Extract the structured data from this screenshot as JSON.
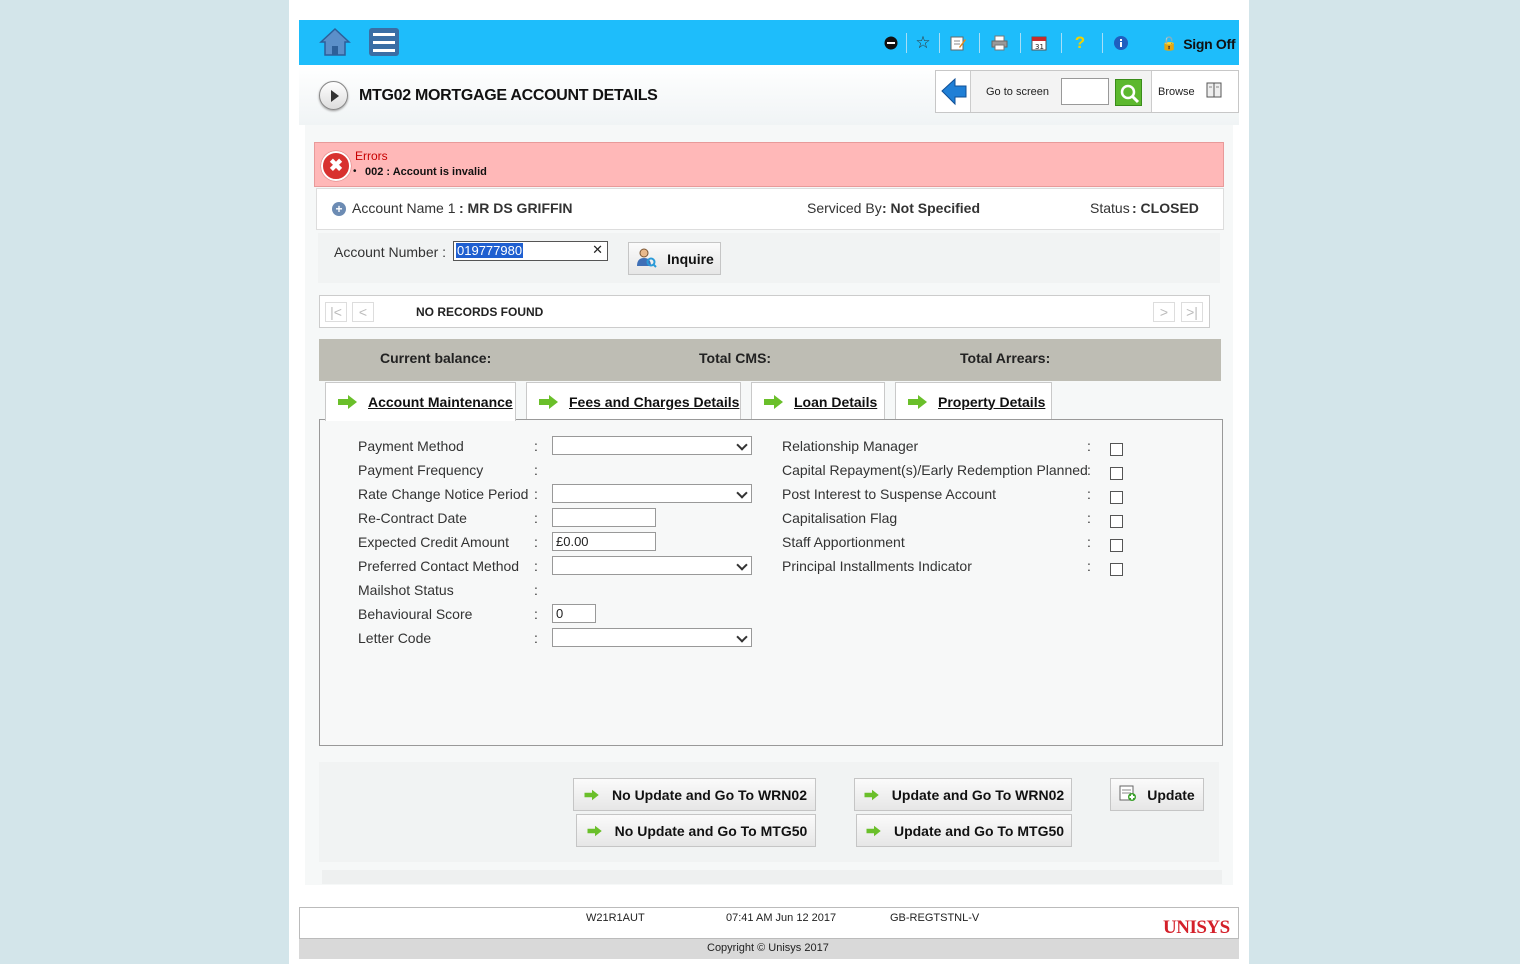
{
  "toolbar": {
    "sign_off": "Sign Off"
  },
  "title": "MTG02 MORTGAGE ACCOUNT DETAILS",
  "goto": {
    "label": "Go to screen",
    "value": "",
    "browse": "Browse"
  },
  "errors": {
    "title": "Errors",
    "message": "002 : Account is invalid"
  },
  "account_header": {
    "name_label": "Account Name 1",
    "name_value": ": MR DS GRIFFIN",
    "serviced_label": "Serviced By",
    "serviced_value": ": Not Specified",
    "status_label": "Status",
    "status_value": ": CLOSED"
  },
  "account_number": {
    "label": "Account Number :",
    "value": "019777980",
    "inquire": "Inquire"
  },
  "records": {
    "text": "NO RECORDS FOUND"
  },
  "summary": {
    "current_balance": "Current balance:",
    "total_cms": "Total CMS:",
    "total_arrears": "Total Arrears:"
  },
  "tabs": [
    {
      "label": "Account Maintenance"
    },
    {
      "label": "Fees and Charges Details"
    },
    {
      "label": "Loan Details"
    },
    {
      "label": "Property Details"
    }
  ],
  "form_left": [
    {
      "label": "Payment Method",
      "type": "select",
      "value": ""
    },
    {
      "label": "Payment Frequency",
      "type": "none",
      "value": ""
    },
    {
      "label": "Rate Change Notice Period",
      "type": "select",
      "value": ""
    },
    {
      "label": "Re-Contract Date",
      "type": "text",
      "value": ""
    },
    {
      "label": "Expected Credit Amount",
      "type": "text",
      "value": "£0.00"
    },
    {
      "label": "Preferred Contact Method",
      "type": "select",
      "value": ""
    },
    {
      "label": "Mailshot Status",
      "type": "none",
      "value": ""
    },
    {
      "label": "Behavioural Score",
      "type": "text",
      "value": "0"
    },
    {
      "label": "Letter Code",
      "type": "select",
      "value": ""
    }
  ],
  "form_right": [
    {
      "label": "Relationship Manager",
      "checked": false
    },
    {
      "label": "Capital Repayment(s)/Early Redemption Planned",
      "checked": false
    },
    {
      "label": "Post Interest to Suspense Account",
      "checked": false
    },
    {
      "label": "Capitalisation Flag",
      "checked": false
    },
    {
      "label": "Staff Apportionment",
      "checked": false
    },
    {
      "label": "Principal Installments Indicator",
      "checked": false
    }
  ],
  "actions": {
    "no_update_wrn02": "No Update and Go To WRN02",
    "update_wrn02": "Update and Go To WRN02",
    "update": "Update",
    "no_update_mtg50": "No Update and Go To MTG50",
    "update_mtg50": "Update and Go To MTG50"
  },
  "footer": {
    "user": "W21R1AUT",
    "datetime": "07:41 AM Jun 12 2017",
    "region": "GB-REGTSTNL-V",
    "logo": "UNISYS",
    "copyright": "Copyright © Unisys 2017"
  }
}
